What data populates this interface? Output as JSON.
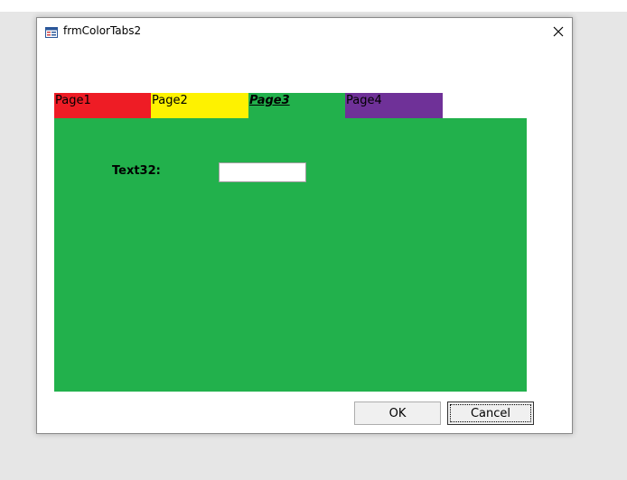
{
  "window": {
    "title": "frmColorTabs2",
    "title_icon": "form-icon",
    "close_icon": "close-icon"
  },
  "tabs": [
    {
      "label": "Page1",
      "color": "#ee1c25",
      "active": false
    },
    {
      "label": "Page2",
      "color": "#fef200",
      "active": false
    },
    {
      "label": "Page3",
      "color": "#22b14c",
      "active": true
    },
    {
      "label": "Page4",
      "color": "#6f3198",
      "active": false
    }
  ],
  "page": {
    "background": "#22b14c",
    "field_label": "Text32:",
    "field_value": ""
  },
  "buttons": {
    "ok": "OK",
    "cancel": "Cancel"
  }
}
